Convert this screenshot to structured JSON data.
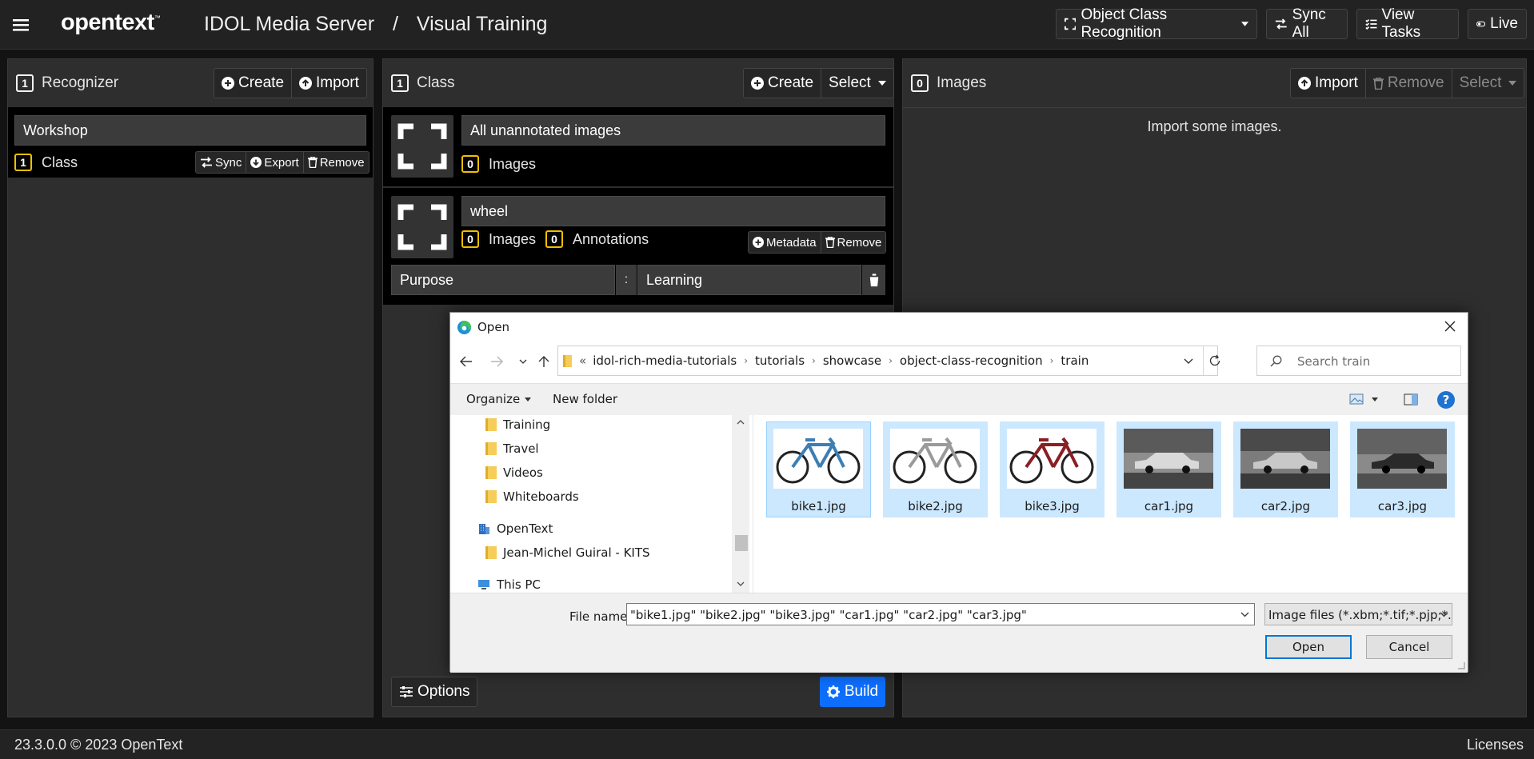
{
  "header": {
    "brand": "opentext",
    "brand_tm": "™",
    "app": "IDOL Media Server",
    "separator": "/",
    "section": "Visual Training",
    "mode_select": "Object Class Recognition",
    "sync_all": "Sync All",
    "view_tasks": "View Tasks",
    "live": "Live"
  },
  "recognizer_panel": {
    "count": "1",
    "title": "Recognizer",
    "create": "Create",
    "import": "Import",
    "item": {
      "name": "Workshop",
      "class_count": "1",
      "class_label": "Class",
      "sync": "Sync",
      "export": "Export",
      "remove": "Remove"
    }
  },
  "class_panel": {
    "count": "1",
    "title": "Class",
    "create": "Create",
    "select": "Select",
    "items": [
      {
        "name": "All unannotated images",
        "images_count": "0",
        "images_label": "Images"
      },
      {
        "name": "wheel",
        "images_count": "0",
        "images_label": "Images",
        "annotations_count": "0",
        "annotations_label": "Annotations",
        "metadata": "Metadata",
        "remove": "Remove"
      }
    ],
    "metadata_row": {
      "key": "Purpose",
      "sep": ":",
      "value": "Learning"
    },
    "options": "Options",
    "build": "Build"
  },
  "images_panel": {
    "count": "0",
    "title": "Images",
    "import": "Import",
    "remove": "Remove",
    "select": "Select",
    "empty_message": "Import some images."
  },
  "dialog": {
    "title": "Open",
    "breadcrumb_prefix": "«",
    "breadcrumb": [
      "idol-rich-media-tutorials",
      "tutorials",
      "showcase",
      "object-class-recognition",
      "train"
    ],
    "search_placeholder": "Search train",
    "organize": "Organize",
    "new_folder": "New folder",
    "tree": [
      {
        "label": "Training",
        "type": "folder"
      },
      {
        "label": "Travel",
        "type": "folder"
      },
      {
        "label": "Videos",
        "type": "folder"
      },
      {
        "label": "Whiteboards",
        "type": "folder"
      },
      {
        "label": "OpenText",
        "type": "org"
      },
      {
        "label": "Jean-Michel Guiral - KITS",
        "type": "folder"
      },
      {
        "label": "This PC",
        "type": "pc"
      }
    ],
    "files": [
      {
        "name": "bike1.jpg",
        "kind": "bike",
        "color": "#3b7fb5"
      },
      {
        "name": "bike2.jpg",
        "kind": "bike",
        "color": "#9a9a9a"
      },
      {
        "name": "bike3.jpg",
        "kind": "bike",
        "color": "#8a1f24"
      },
      {
        "name": "car1.jpg",
        "kind": "car"
      },
      {
        "name": "car2.jpg",
        "kind": "car"
      },
      {
        "name": "car3.jpg",
        "kind": "car"
      }
    ],
    "file_name_label": "File name:",
    "file_name_value": "\"bike1.jpg\" \"bike2.jpg\" \"bike3.jpg\" \"car1.jpg\" \"car2.jpg\" \"car3.jpg\"",
    "file_type": "Image files (*.xbm;*.tif;*.pjp;*.ap",
    "open": "Open",
    "cancel": "Cancel"
  },
  "footer": {
    "version": "23.3.0.0 © 2023 OpenText",
    "licenses": "Licenses"
  }
}
